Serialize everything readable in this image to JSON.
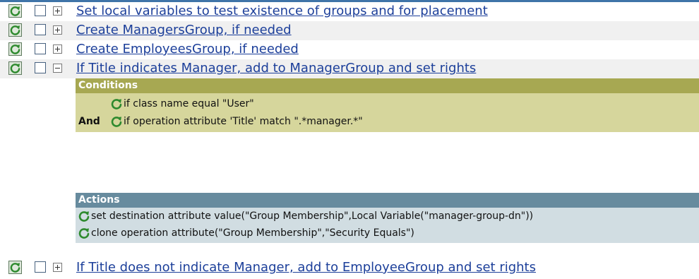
{
  "rules": [
    {
      "label": "Set local variables to test existence of groups and for placement",
      "expanded": false
    },
    {
      "label": "Create ManagersGroup, if needed",
      "expanded": false
    },
    {
      "label": "Create EmployeesGroup, if needed",
      "expanded": false
    },
    {
      "label": "If Title indicates Manager, add to ManagerGroup and set rights",
      "expanded": true
    },
    {
      "label": "If Title does not indicate Manager, add to EmployeeGroup and set rights",
      "expanded": false
    }
  ],
  "conditions": {
    "header": "Conditions",
    "connector": "And",
    "items": [
      "if class name equal \"User\"",
      "if operation attribute 'Title' match \".*manager.*\""
    ]
  },
  "actions": {
    "header": "Actions",
    "items": [
      "set destination attribute value(\"Group Membership\",Local Variable(\"manager-group-dn\"))",
      "clone operation attribute(\"Group Membership\",\"Security Equals\")"
    ]
  },
  "colors": {
    "link": "#1c3f9a",
    "conditions_header": "#a7a852",
    "conditions_body": "#d6d69c",
    "actions_header": "#678b9e",
    "actions_body": "#d1dde2",
    "enable_icon": "#2e8a2e"
  },
  "icons": {
    "rule_enabled": "enabled-refresh-icon",
    "expand": "plus-box-icon",
    "collapse": "minus-box-icon",
    "item": "green-refresh-icon"
  }
}
